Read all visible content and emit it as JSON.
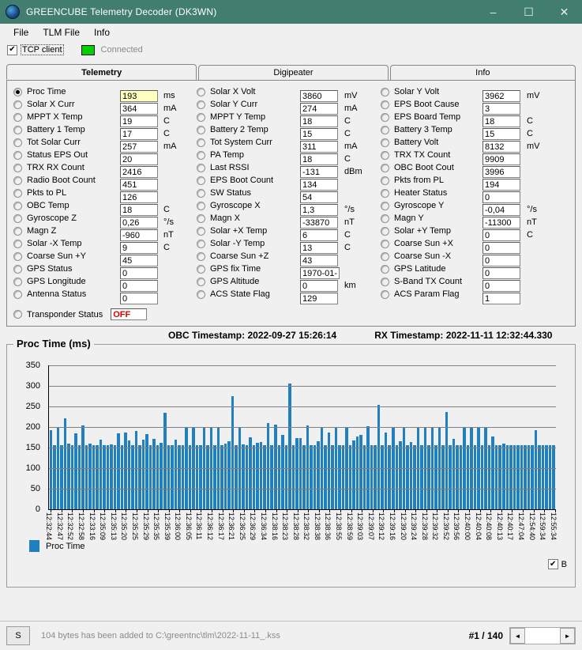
{
  "window": {
    "title": "GREENCUBE Telemetry Decoder (DK3WN)",
    "icon": "globe-icon",
    "minimize": "–",
    "maximize": "☐",
    "close": "✕"
  },
  "menu": [
    "File",
    "TLM File",
    "Info"
  ],
  "connection": {
    "tcp_checked": "✔",
    "tcp_label": "TCP client",
    "status_text": "Connected",
    "led_color": "#00d000"
  },
  "tabs": [
    {
      "label": "Telemetry",
      "selected": true
    },
    {
      "label": "Digipeater",
      "selected": false
    },
    {
      "label": "Info",
      "selected": false
    }
  ],
  "telemetry": {
    "col1": [
      {
        "label": "Proc Time",
        "value": "193",
        "unit": "ms",
        "selected": true,
        "highlight": true
      },
      {
        "label": "Solar X Curr",
        "value": "364",
        "unit": "mA"
      },
      {
        "label": "MPPT X Temp",
        "value": "19",
        "unit": "C"
      },
      {
        "label": "Battery 1 Temp",
        "value": "17",
        "unit": "C"
      },
      {
        "label": "Tot Solar Curr",
        "value": "257",
        "unit": "mA"
      },
      {
        "label": "Status EPS Out",
        "value": "20",
        "unit": ""
      },
      {
        "label": "TRX RX Count",
        "value": "2416",
        "unit": ""
      },
      {
        "label": "Radio Boot Count",
        "value": "451",
        "unit": ""
      },
      {
        "label": "Pkts to PL",
        "value": "126",
        "unit": ""
      },
      {
        "label": "OBC Temp",
        "value": "18",
        "unit": "C"
      },
      {
        "label": "Gyroscope Z",
        "value": "0,26",
        "unit": "°/s"
      },
      {
        "label": "Magn Z",
        "value": "-960",
        "unit": "nT"
      },
      {
        "label": "Solar -X Temp",
        "value": "9",
        "unit": "C"
      },
      {
        "label": "Coarse Sun +Y",
        "value": "45",
        "unit": ""
      },
      {
        "label": "GPS Status",
        "value": "0",
        "unit": ""
      },
      {
        "label": "GPS Longitude",
        "value": "0",
        "unit": ""
      },
      {
        "label": "Antenna Status",
        "value": "0",
        "unit": ""
      }
    ],
    "col2": [
      {
        "label": "Solar X Volt",
        "value": "3860",
        "unit": "mV"
      },
      {
        "label": "Solar Y Curr",
        "value": "274",
        "unit": "mA"
      },
      {
        "label": "MPPT Y Temp",
        "value": "18",
        "unit": "C"
      },
      {
        "label": "Battery 2 Temp",
        "value": "15",
        "unit": "C"
      },
      {
        "label": "Tot System Curr",
        "value": "311",
        "unit": "mA"
      },
      {
        "label": "PA Temp",
        "value": "18",
        "unit": "C"
      },
      {
        "label": "Last RSSI",
        "value": "-131",
        "unit": "dBm"
      },
      {
        "label": "EPS Boot Count",
        "value": "134",
        "unit": ""
      },
      {
        "label": "SW Status",
        "value": "54",
        "unit": ""
      },
      {
        "label": "Gyroscope X",
        "value": "1,3",
        "unit": "°/s"
      },
      {
        "label": "Magn X",
        "value": "-33870",
        "unit": "nT"
      },
      {
        "label": "Solar +X Temp",
        "value": "6",
        "unit": "C"
      },
      {
        "label": "Solar -Y Temp",
        "value": "13",
        "unit": "C"
      },
      {
        "label": "Coarse Sun +Z",
        "value": "43",
        "unit": ""
      },
      {
        "label": "GPS fix Time",
        "value": "1970-01-",
        "unit": ""
      },
      {
        "label": "GPS Altitude",
        "value": "0",
        "unit": "km"
      },
      {
        "label": "ACS State Flag",
        "value": "129",
        "unit": ""
      }
    ],
    "col3": [
      {
        "label": "Solar Y Volt",
        "value": "3962",
        "unit": "mV"
      },
      {
        "label": "EPS Boot Cause",
        "value": "3",
        "unit": ""
      },
      {
        "label": "EPS Board Temp",
        "value": "18",
        "unit": "C"
      },
      {
        "label": "Battery 3 Temp",
        "value": "15",
        "unit": "C"
      },
      {
        "label": "Battery Volt",
        "value": "8132",
        "unit": "mV"
      },
      {
        "label": "TRX TX Count",
        "value": "9909",
        "unit": ""
      },
      {
        "label": "OBC Boot Cout",
        "value": "3996",
        "unit": ""
      },
      {
        "label": "Pkts from PL",
        "value": "194",
        "unit": ""
      },
      {
        "label": "Heater Status",
        "value": "0",
        "unit": ""
      },
      {
        "label": "Gyroscope Y",
        "value": "-0,04",
        "unit": "°/s"
      },
      {
        "label": "Magn Y",
        "value": "-11300",
        "unit": "nT"
      },
      {
        "label": "Solar +Y Temp",
        "value": "0",
        "unit": "C"
      },
      {
        "label": "Coarse Sun +X",
        "value": "0",
        "unit": ""
      },
      {
        "label": "Coarse Sun -X",
        "value": "0",
        "unit": ""
      },
      {
        "label": "GPS Latitude",
        "value": "0",
        "unit": ""
      },
      {
        "label": "S-Band TX Count",
        "value": "0",
        "unit": ""
      },
      {
        "label": "ACS Param Flag",
        "value": "1",
        "unit": ""
      }
    ],
    "transponder": {
      "label": "Transponder Status",
      "value": "OFF",
      "color": "#e00000"
    }
  },
  "timestamps": {
    "obc": "OBC Timestamp: 2022-09-27 15:26:14",
    "rx": "RX Timestamp: 2022-11-11 12:32:44.330"
  },
  "chart_data": {
    "type": "bar",
    "title": "Proc Time (ms)",
    "xlabel": "",
    "ylabel": "",
    "ylim": [
      0,
      350
    ],
    "yticks": [
      0,
      50,
      100,
      150,
      200,
      250,
      300,
      350
    ],
    "grid": true,
    "legend_position": "bottom-left",
    "series": [
      {
        "name": "Proc Time",
        "color": "#1f7fbf",
        "values": [
          193,
          155,
          199,
          155,
          222,
          160,
          155,
          184,
          155,
          204,
          155,
          160,
          155,
          155,
          169,
          155,
          155,
          158,
          155,
          184,
          155,
          187,
          168,
          155,
          191,
          155,
          170,
          182,
          155,
          172,
          155,
          162,
          234,
          155,
          155,
          170,
          155,
          155,
          199,
          155,
          199,
          155,
          155,
          199,
          155,
          199,
          155,
          199,
          155,
          160,
          165,
          275,
          155,
          199,
          158,
          155,
          175,
          155,
          162,
          163,
          155,
          210,
          155,
          206,
          155,
          180,
          155,
          305,
          155,
          174,
          174,
          155,
          203,
          155,
          155,
          165,
          199,
          155,
          187,
          155,
          199,
          155,
          155,
          199,
          155,
          168,
          177,
          180,
          155,
          201,
          155,
          155,
          253,
          155,
          186,
          155,
          199,
          155,
          165,
          199,
          155,
          163,
          155,
          199,
          155,
          199,
          155,
          199,
          155,
          199,
          155,
          236,
          155,
          172,
          155,
          155,
          199,
          155,
          199,
          155,
          199,
          155,
          199,
          155,
          176,
          155,
          155,
          160,
          155,
          155,
          155,
          155,
          155,
          155,
          155,
          155,
          193,
          155,
          155,
          155,
          155,
          155
        ]
      }
    ],
    "categories": [
      "12:32:44",
      "12:32:47",
      "12:32:52",
      "12:32:58",
      "12:33:16",
      "12:35:09",
      "12:35:13",
      "12:35:20",
      "12:35:25",
      "12:35:29",
      "12:35:35",
      "12:35:39",
      "12:36:00",
      "12:36:05",
      "12:36:11",
      "12:36:12",
      "12:36:17",
      "12:36:21",
      "12:36:25",
      "12:36:29",
      "12:36:34",
      "12:38:16",
      "12:38:23",
      "12:38:28",
      "12:38:32",
      "12:38:38",
      "12:38:36",
      "12:38:55",
      "12:38:59",
      "12:39:03",
      "12:39:07",
      "12:39:12",
      "12:39:16",
      "12:39:20",
      "12:39:24",
      "12:39:28",
      "12:39:32",
      "12:39:52",
      "12:39:56",
      "12:40:00",
      "12:40:04",
      "12:40:08",
      "12:40:13",
      "12:40:17",
      "12:47:04",
      "12:54:40",
      "12:59:34",
      "12:55:34"
    ],
    "label_interval": 3
  },
  "legend": {
    "label": "Proc Time",
    "swatch_color": "#1f7fbf"
  },
  "b_checkbox": {
    "label": "B",
    "checked": "✔"
  },
  "statusbar": {
    "s_button": "S",
    "message": "104 bytes has been added to C:\\greentnc\\tlm\\2022-11-11_.kss",
    "page_counter": "#1 / 140",
    "scroll_left": "◄",
    "scroll_right": "►"
  }
}
